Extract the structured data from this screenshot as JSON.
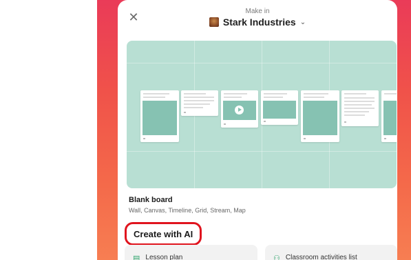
{
  "header": {
    "make_in_label": "Make in",
    "workspace_name": "Stark Industries",
    "close_icon": "close-icon",
    "dropdown_icon": "chevron-down-icon"
  },
  "blank_board": {
    "title": "Blank board",
    "formats": "Wall, Canvas, Timeline, Grid, Stream, Map"
  },
  "ai_section": {
    "heading": "Create with AI",
    "tiles": [
      {
        "label": "Lesson plan",
        "icon": "document-icon"
      },
      {
        "label": "Classroom activities list",
        "icon": "nodes-icon"
      }
    ]
  },
  "colors": {
    "backdrop_top": "#ea3b58",
    "backdrop_bottom": "#f77e52",
    "preview_bg": "#b8dfd3",
    "highlight_border": "#e0141e",
    "icon_green": "#2fa46c"
  }
}
